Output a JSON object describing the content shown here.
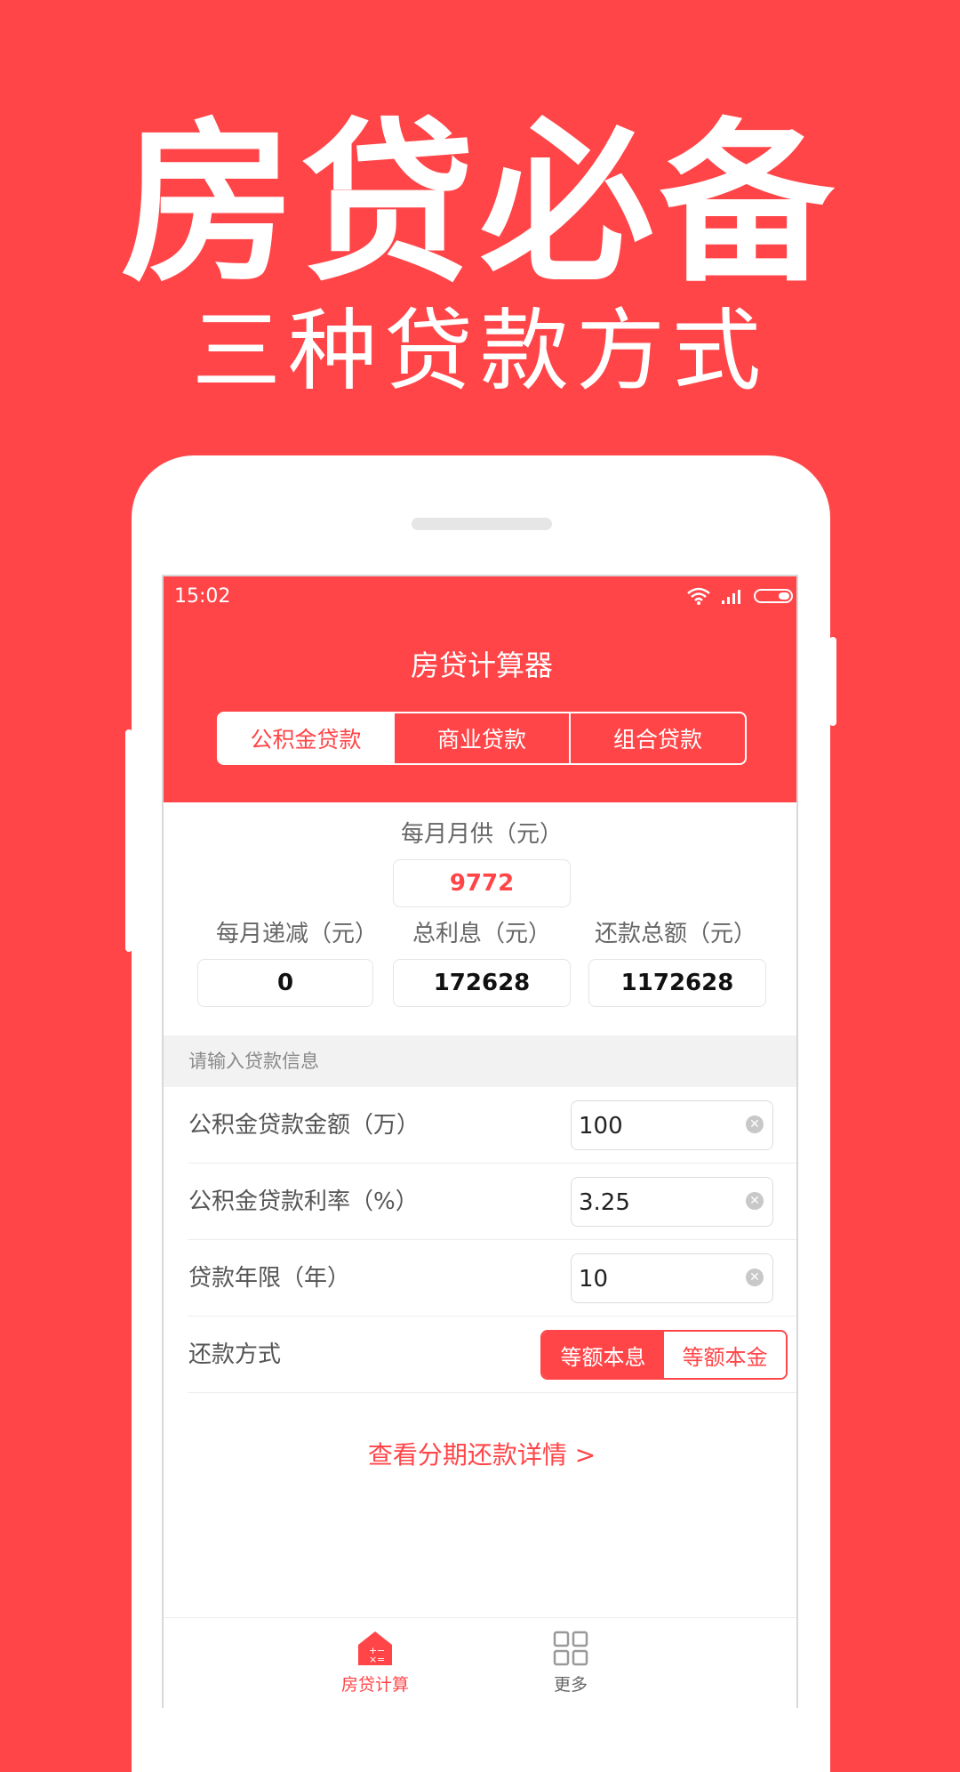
{
  "promo": {
    "title": "房贷必备",
    "subtitle": "三种贷款方式"
  },
  "status_bar": {
    "time": "15:02"
  },
  "app": {
    "title": "房贷计算器"
  },
  "tabs": [
    {
      "label": "公积金贷款",
      "active": true
    },
    {
      "label": "商业贷款",
      "active": false
    },
    {
      "label": "组合贷款",
      "active": false
    }
  ],
  "results": {
    "monthly_payment_label": "每月月供（元）",
    "monthly_payment_value": "9772",
    "monthly_decrease_label": "每月递减（元）",
    "monthly_decrease_value": "0",
    "total_interest_label": "总利息（元）",
    "total_interest_value": "172628",
    "total_repayment_label": "还款总额（元）",
    "total_repayment_value": "1172628"
  },
  "form": {
    "section_title": "请输入贷款信息",
    "amount_label": "公积金贷款金额（万）",
    "amount_value": "100",
    "rate_label": "公积金贷款利率（%）",
    "rate_value": "3.25",
    "term_label": "贷款年限（年）",
    "term_value": "10",
    "method_label": "还款方式",
    "method_options": [
      {
        "label": "等额本息",
        "active": true
      },
      {
        "label": "等额本金",
        "active": false
      }
    ]
  },
  "detail_link": "查看分期还款详情 >",
  "bottom_nav": [
    {
      "label": "房贷计算",
      "icon": "house-calculator-icon",
      "active": true
    },
    {
      "label": "更多",
      "icon": "grid-icon",
      "active": false
    }
  ],
  "colors": {
    "accent": "#ff4548",
    "text_muted": "#666666"
  }
}
